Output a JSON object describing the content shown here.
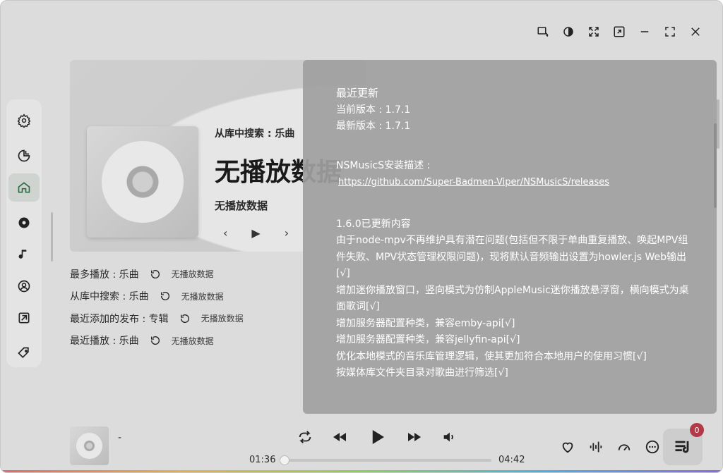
{
  "hero": {
    "subtitle": "从库中搜索 : 乐曲",
    "title": "无播放数据",
    "no_data": "无播放数据",
    "prev": "‹",
    "play": "▶",
    "next": "›"
  },
  "lists": [
    {
      "label": "最多播放 : 乐曲",
      "value": "无播放数据"
    },
    {
      "label": "从库中搜索 : 乐曲",
      "value": "无播放数据"
    },
    {
      "label": "最近添加的发布 : 专辑",
      "value": "无播放数据"
    },
    {
      "label": "最近播放 : 乐曲",
      "value": "无播放数据"
    }
  ],
  "panel": {
    "title": "最近更新",
    "current_version": "当前版本 : 1.7.1",
    "latest_version": "最新版本 : 1.7.1",
    "install_desc": "NSMusicS安装描述 :",
    "link": "https://github.com/Super-Badmen-Viper/NSMusicS/releases",
    "changelog_title": "1.6.0已更新内容",
    "lines": [
      "由于node-mpv不再维护具有潜在问题(包括但不限于单曲重复播放、唤起MPV组件失败、MPV状态管理权限问题)，现将默认音频输出设置为howler.js Web输出[√]",
      "增加迷你播放窗口，竖向模式为仿制AppleMusic迷你播放悬浮窗，横向模式为桌面歌词[√]",
      "增加服务器配置种类，兼容emby-api[√]",
      "增加服务器配置种类，兼容jellyfin-api[√]",
      "优化本地模式的音乐库管理逻辑，使其更加符合本地用户的使用习惯[√]",
      "按媒体库文件夹目录对歌曲进行筛选[√]"
    ]
  },
  "player": {
    "song": "-",
    "time_current": "01:36",
    "time_total": "04:42",
    "progress": 0.0,
    "queue_count": "0"
  },
  "colors": {
    "badge": "#b23a48",
    "panel_bg": "#a0a0a0"
  }
}
